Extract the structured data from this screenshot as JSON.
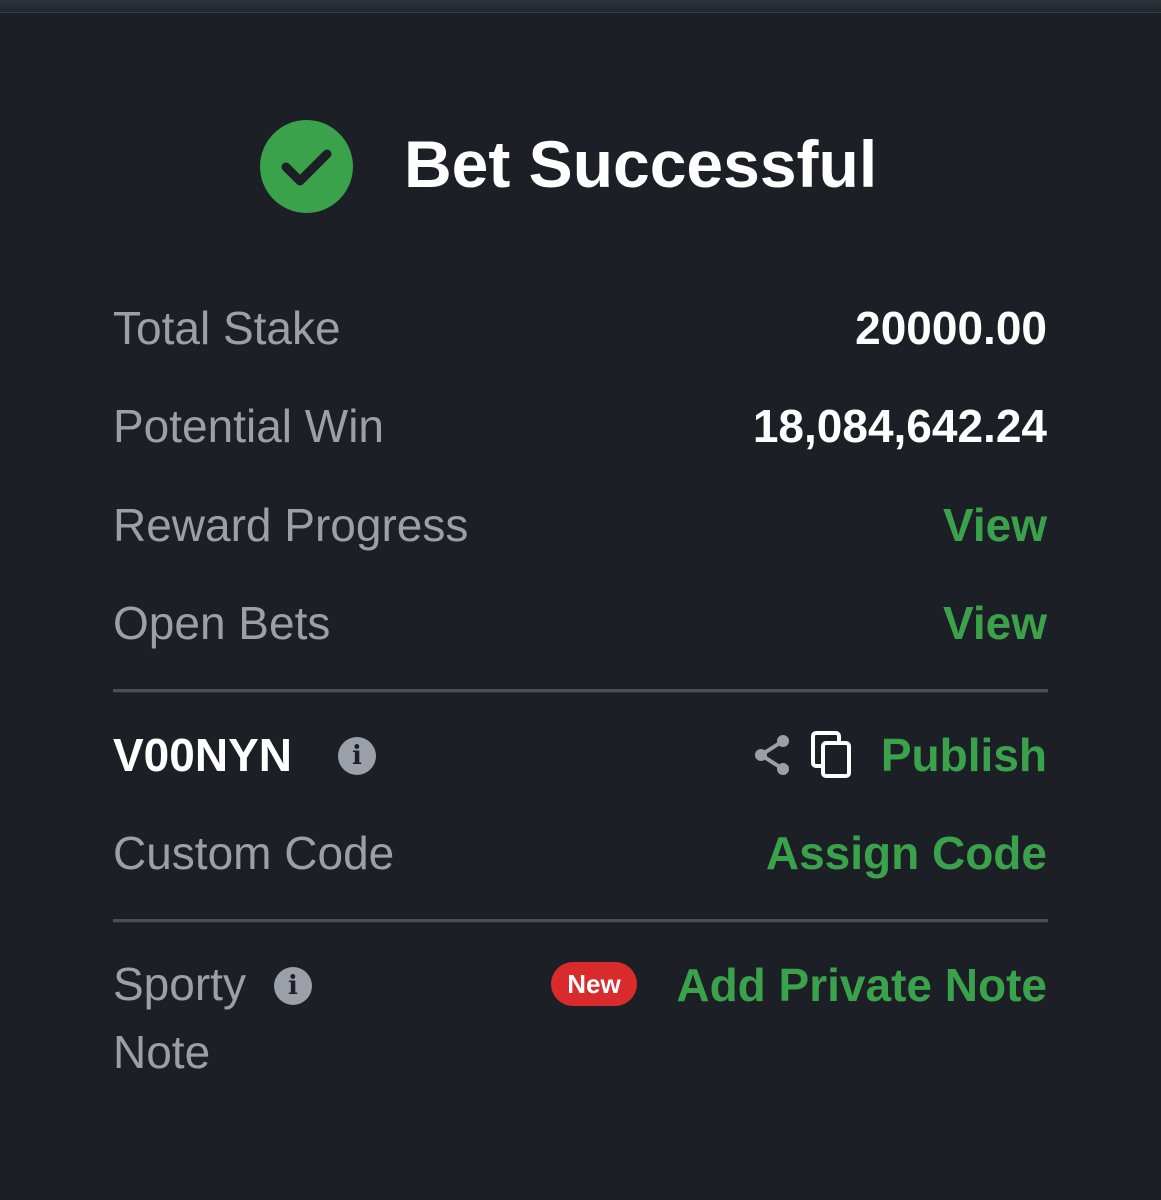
{
  "header": {
    "title": "Bet Successful",
    "icon": "check-circle-icon"
  },
  "summary": {
    "total_stake_label": "Total Stake",
    "total_stake_value": "20000.00",
    "potential_win_label": "Potential Win",
    "potential_win_value": "18,084,642.24",
    "reward_progress_label": "Reward Progress",
    "reward_progress_link": "View",
    "open_bets_label": "Open Bets",
    "open_bets_link": "View"
  },
  "booking": {
    "code": "V00NYN",
    "publish_label": "Publish",
    "custom_code_label": "Custom Code",
    "assign_code_link": "Assign Code"
  },
  "note": {
    "label_line1": "Sporty",
    "label_line2": "Note",
    "badge": "New",
    "add_note_link": "Add Private Note"
  },
  "colors": {
    "background": "#1c1f26",
    "accent_green": "#3aa24a",
    "label_gray": "#9ba0a8",
    "badge_red": "#d92b2b"
  }
}
